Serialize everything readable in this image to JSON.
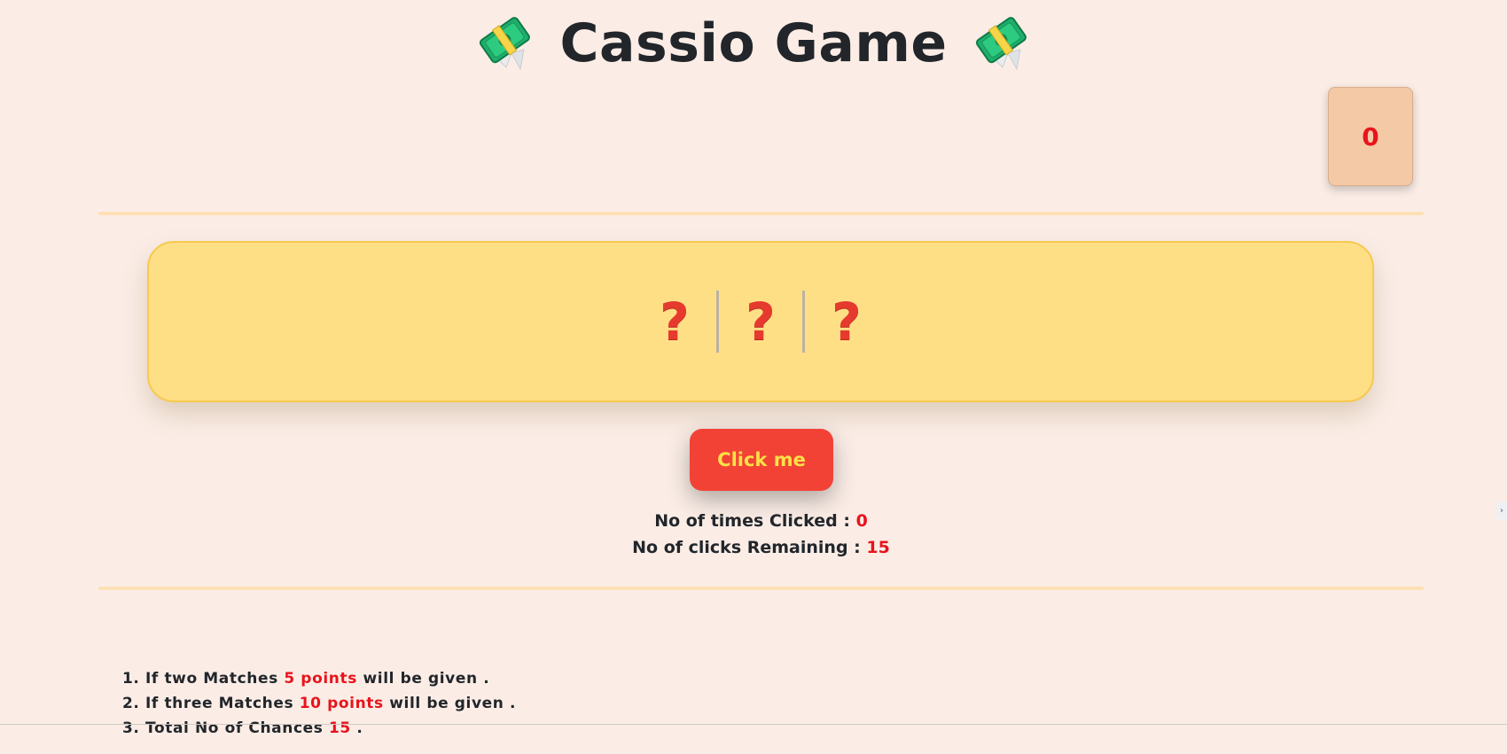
{
  "header": {
    "title": "Cassio Game",
    "left_icon": "money-with-wings-icon",
    "right_icon": "money-with-wings-icon"
  },
  "score": {
    "value": "0"
  },
  "slots": [
    {
      "symbol": "?"
    },
    {
      "symbol": "?"
    },
    {
      "symbol": "?"
    }
  ],
  "controls": {
    "button_label": "Click me"
  },
  "stats": {
    "clicked_label": "No of times Clicked :",
    "clicked_value": "0",
    "remaining_label": "No of clicks Remaining :",
    "remaining_value": "15"
  },
  "rules": [
    {
      "prefix": "1. If two Matches",
      "highlight": "5 points",
      "suffix": "will be given ."
    },
    {
      "prefix": "2. If three Matches",
      "highlight": "10 points",
      "suffix": "will be given ."
    },
    {
      "prefix": "3. Total No of Chances",
      "highlight": "15",
      "suffix": "."
    }
  ],
  "colors": {
    "background": "#fbede6",
    "panel": "#ffdf86",
    "button": "#f24236",
    "button_text": "#fde047",
    "accent_red": "#e8141c",
    "score_box": "#f3c9a6"
  },
  "side_tab": {
    "glyph": "›"
  }
}
